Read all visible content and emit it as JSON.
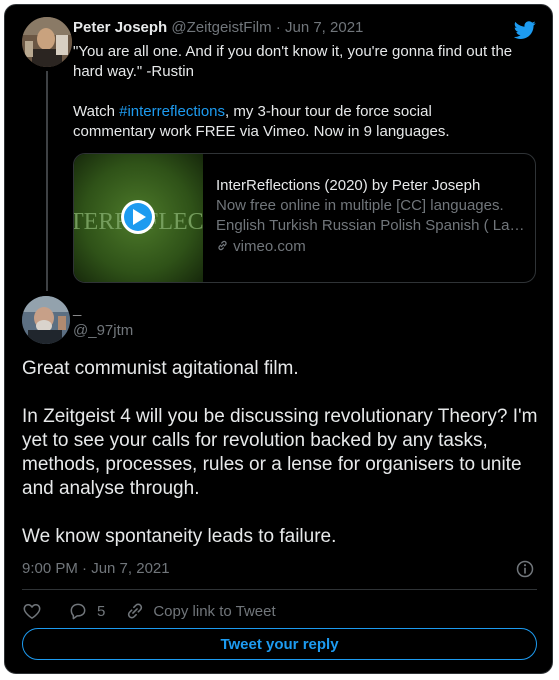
{
  "original_tweet": {
    "author_name": "Peter Joseph",
    "handle": "@ZeitgeistFilm",
    "separator": " · ",
    "date": "Jun 7, 2021",
    "text_line1": "\"You are all one. And if you don't know it, you're gonna find out the hard way.\" -Rustin",
    "text_prefix": "Watch ",
    "hashtag": "#interreflections",
    "text_suffix": ", my 3-hour tour de force social commentary work FREE via Vimeo. Now in 9 languages.",
    "link_card": {
      "thumbnail_text": "TERREFLECTIO",
      "title": "InterReflections (2020) by Peter Joseph",
      "description_line1": "Now free online in multiple [CC] languages.",
      "description_line2": "English Turkish Russian Polish Spanish ( Latin…",
      "domain": "vimeo.com"
    }
  },
  "reply_tweet": {
    "author_name": "_",
    "handle": "@_97jtm",
    "paragraphs": [
      "Great communist agitational film.",
      "In Zeitgeist 4 will you be discussing revolutionary Theory? I'm yet to see your calls for revolution backed by any tasks, methods, processes, rules or a lense for organisers to unite and analyse through.",
      "We know spontaneity leads to failure."
    ],
    "timestamp": "9:00 PM · Jun 7, 2021",
    "reply_count": "5",
    "copy_link_label": "Copy link to Tweet"
  },
  "reply_button_label": "Tweet your reply",
  "icons": [
    "twitter-bird-icon",
    "play-icon",
    "link-icon",
    "info-icon",
    "heart-icon",
    "reply-bubble-icon",
    "chain-link-icon"
  ],
  "colors": {
    "background": "#000000",
    "text": "#e7e9ea",
    "muted": "#71767b",
    "accent": "#1d9bf0",
    "border": "#2f3336"
  }
}
